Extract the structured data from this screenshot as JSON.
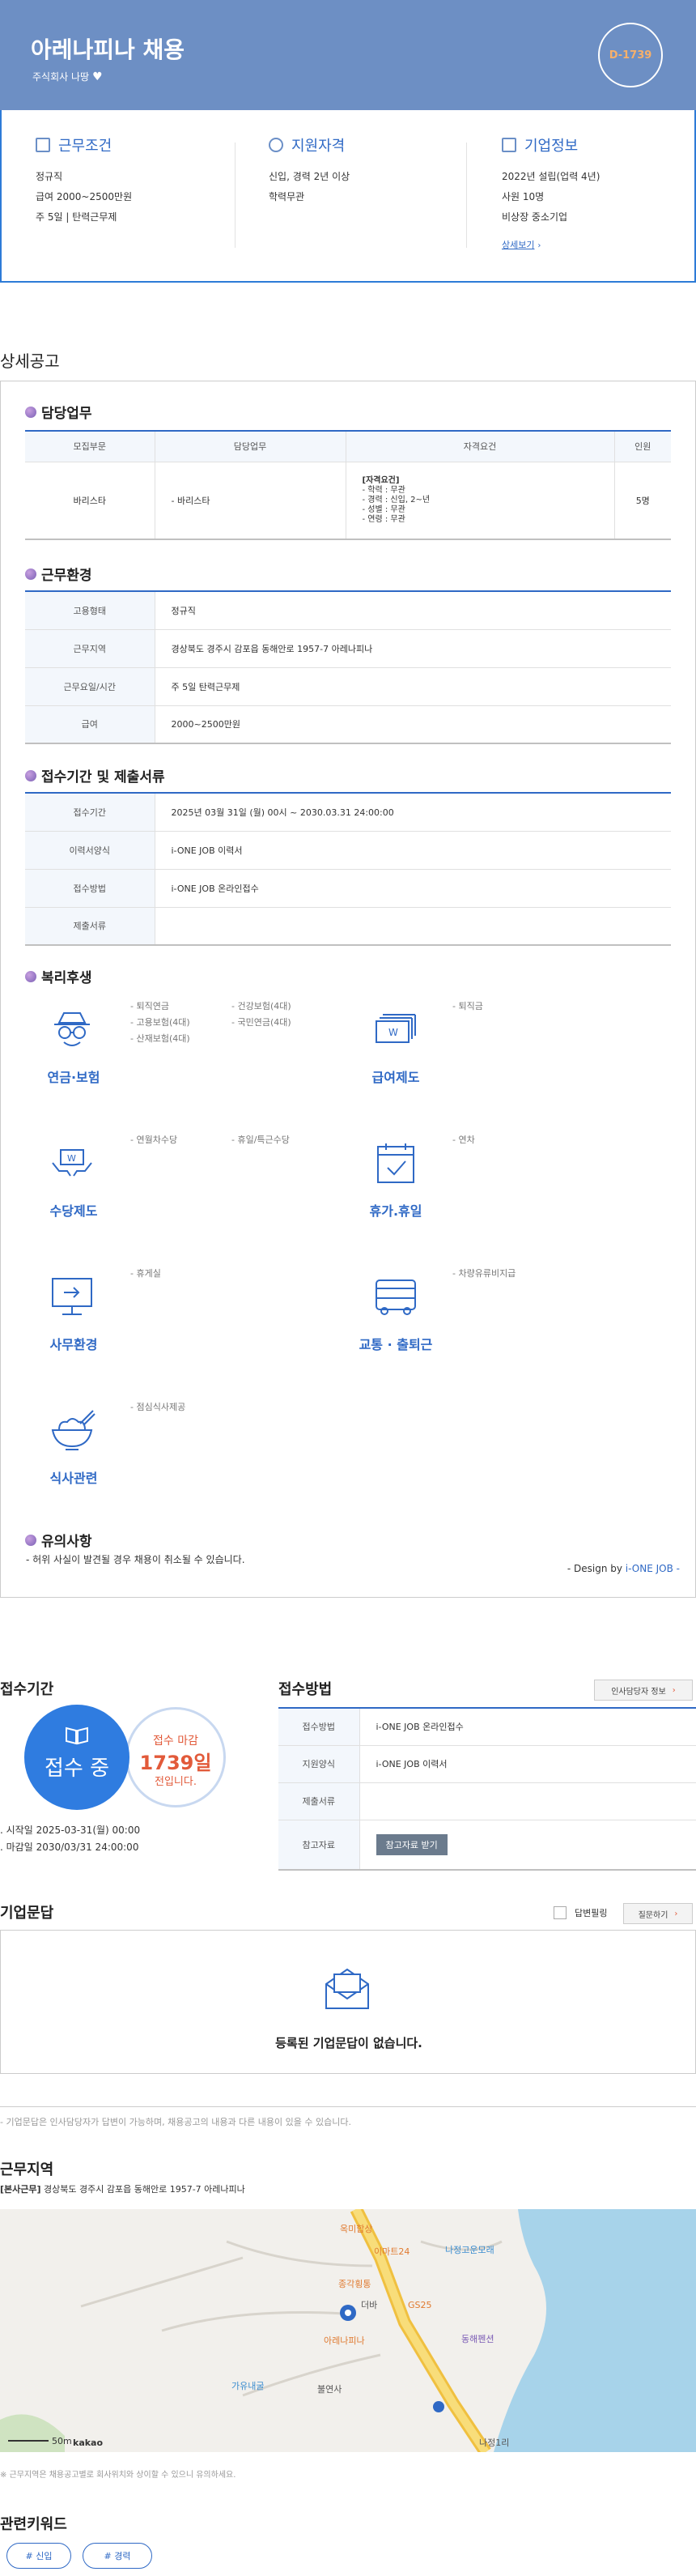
{
  "header": {
    "title": "아레나피나 채용",
    "company": "주식회사 나땅",
    "dday": "D-1739"
  },
  "summary": {
    "work_conditions": {
      "title": "근무조건",
      "lines": [
        "정규직",
        "급여 2000~2500만원",
        "주 5일 | 탄력근무제"
      ]
    },
    "qualifications": {
      "title": "지원자격",
      "lines": [
        "신입, 경력 2년 이상",
        "학력무관"
      ]
    },
    "company_info": {
      "title": "기업정보",
      "lines": [
        "2022년 설립(업력 4년)",
        "사원 10명",
        "비상장 중소기업"
      ],
      "more_label": "상세보기"
    }
  },
  "detail": {
    "section_title": "상세공고",
    "duties": {
      "title": "담당업무",
      "headers": [
        "모집부문",
        "담당업무",
        "자격요건",
        "인원"
      ],
      "row": {
        "dept": "바리스타",
        "task": "- 바리스타",
        "req_title": "[자격요건]",
        "req_lines": [
          "- 학력 : 무관",
          "- 경력 : 신입, 2~년",
          "- 성별 : 무관",
          "- 연령 : 무관"
        ],
        "count": "5명"
      }
    },
    "environment": {
      "title": "근무환경",
      "rows": [
        {
          "label": "고용형태",
          "value": "정규직"
        },
        {
          "label": "근무지역",
          "value": "경상북도 경주시 감포읍 동해안로 1957-7 아레나피나"
        },
        {
          "label": "근무요일/시간",
          "value": "주 5일 탄력근무제"
        },
        {
          "label": "급여",
          "value": "2000~2500만원"
        }
      ]
    },
    "application": {
      "title": "접수기간 및 제출서류",
      "rows": [
        {
          "label": "접수기간",
          "value": "2025년 03월 31일 (월) 00시 ~ 2030.03.31 24:00:00"
        },
        {
          "label": "이력서양식",
          "value": "i-ONE JOB 이력서"
        },
        {
          "label": "접수방법",
          "value": "i-ONE JOB 온라인접수"
        },
        {
          "label": "제출서류",
          "value": ""
        }
      ]
    },
    "welfare": {
      "title": "복리후생",
      "items": [
        {
          "label": "연금·보험",
          "icon": "pension-icon",
          "col1": [
            "- 퇴직연금",
            "- 고용보험(4대)",
            "- 산재보험(4대)"
          ],
          "col2": [
            "- 건강보험(4대)",
            "- 국민연금(4대)"
          ]
        },
        {
          "label": "급여제도",
          "icon": "salary-icon",
          "col1": [
            "- 퇴직금"
          ],
          "col2": []
        },
        {
          "label": "수당제도",
          "icon": "allowance-icon",
          "col1": [
            "- 연월차수당"
          ],
          "col2": [
            "- 휴일/특근수당"
          ]
        },
        {
          "label": "휴가.휴일",
          "icon": "calendar-icon",
          "col1": [
            "- 연차"
          ],
          "col2": []
        },
        {
          "label": "사무환경",
          "icon": "monitor-icon",
          "col1": [
            "- 휴게실"
          ],
          "col2": []
        },
        {
          "label": "교통 · 출퇴근",
          "icon": "bus-icon",
          "col1": [
            "- 차량유류비지급"
          ],
          "col2": []
        },
        {
          "label": "식사관련",
          "icon": "meal-icon",
          "col1": [
            "- 점심식사제공"
          ],
          "col2": []
        }
      ]
    },
    "notice": {
      "title": "유의사항",
      "text": "- 허위 사실이 발견될 경우 채용이 취소될 수 있습니다."
    },
    "design_prefix": "- Design by",
    "design_brand": "i-ONE JOB",
    "design_suffix": "-"
  },
  "apply_period": {
    "title": "접수기간",
    "status": "접수 중",
    "deadline_label": "접수 마감",
    "deadline_days": "1739일",
    "deadline_suffix": "전입니다.",
    "start": "시작일 2025-03-31(월) 00:00",
    "end": "마감일 2030/03/31 24:00:00"
  },
  "apply_method": {
    "title": "접수방법",
    "hr_button": "인사담당자 정보",
    "rows": [
      {
        "label": "접수방법",
        "value": "i-ONE JOB 온라인접수"
      },
      {
        "label": "지원양식",
        "value": "i-ONE JOB 이력서"
      },
      {
        "label": "제출서류",
        "value": ""
      },
      {
        "label": "참고자료",
        "value": ""
      }
    ],
    "ref_button": "참고자료 받기"
  },
  "qa": {
    "title": "기업문답",
    "answered_label": "답변필링",
    "ask_button": "질문하기",
    "empty": "등록된 기업문답이 없습니다.",
    "footnote": "- 기업문답은 인사담당자가 답변이 가능하며, 채용공고의 내용과 다른 내용이 있을 수 있습니다."
  },
  "location": {
    "title": "근무지역",
    "tag": "[본사근무]",
    "address": "경상북도 경주시 감포읍 동해안로 1957-7 아레나피나",
    "map_labels": [
      "옥미합상",
      "이마트24",
      "나정고운모래",
      "종각횡통",
      "GS25",
      "더바",
      "동해펜션",
      "아레나피나",
      "가유내굴",
      "불연사",
      "나정1리"
    ],
    "scale": "50m",
    "brand": "kakao",
    "footnote": "※ 근무지역은 채용공고별로 회사위치와 상이할 수 있으니 유의하세요."
  },
  "keywords": {
    "title": "관련키워드",
    "items": [
      "# 신입",
      "# 경력"
    ]
  }
}
